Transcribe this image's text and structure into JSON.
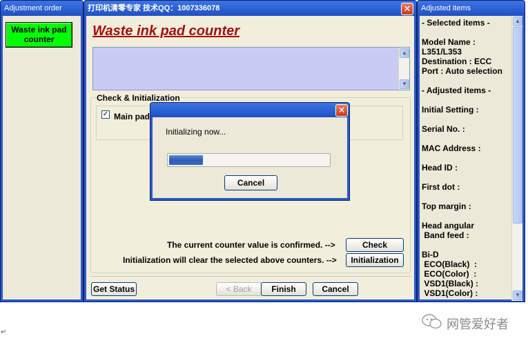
{
  "left_window": {
    "title": "Adjustment order",
    "items": [
      {
        "label": "Waste ink pad counter"
      }
    ]
  },
  "main_window": {
    "title": "打印机清零专家 技术QQ：1007336078",
    "heading": "Waste ink pad counter",
    "group_label": "Check & Initialization",
    "checkbox_label": "Main pad",
    "checkbox_mark": "✓",
    "confirm_text": "The current counter value is confirmed. -->",
    "init_text": "Initialization will clear the selected above counters. -->",
    "check_label": "Check",
    "initialization_label": "Initialization",
    "get_status_label": "Get Status",
    "back_label": "< Back",
    "finish_label": "Finish",
    "cancel_label": "Cancel",
    "close_glyph": "✕"
  },
  "dialog": {
    "message": "Initializing now...",
    "progress": 0.21,
    "cancel_label": "Cancel",
    "close_glyph": "✕"
  },
  "right_window": {
    "title": "Adjusted items",
    "lines": [
      "- Selected items -",
      "Model Name :",
      "L351/L353",
      "Destination : ECC",
      "Port : Auto selection",
      "- Adjusted items -",
      "Initial Setting :",
      "Serial No. :",
      "MAC Address :",
      "Head ID :",
      "First dot :",
      "Top margin :",
      "Head angular",
      " Band feed :",
      "Bi-D",
      " ECO(Black)  :",
      " ECO(Color)  :",
      " VSD1(Black) :",
      " VSD1(Color) :"
    ]
  },
  "watermark": {
    "text": "网管爱好者"
  },
  "colors": {
    "accent_green": "#00ff00",
    "heading_red": "#a31010",
    "progress_blue": "#2f5eb4"
  }
}
